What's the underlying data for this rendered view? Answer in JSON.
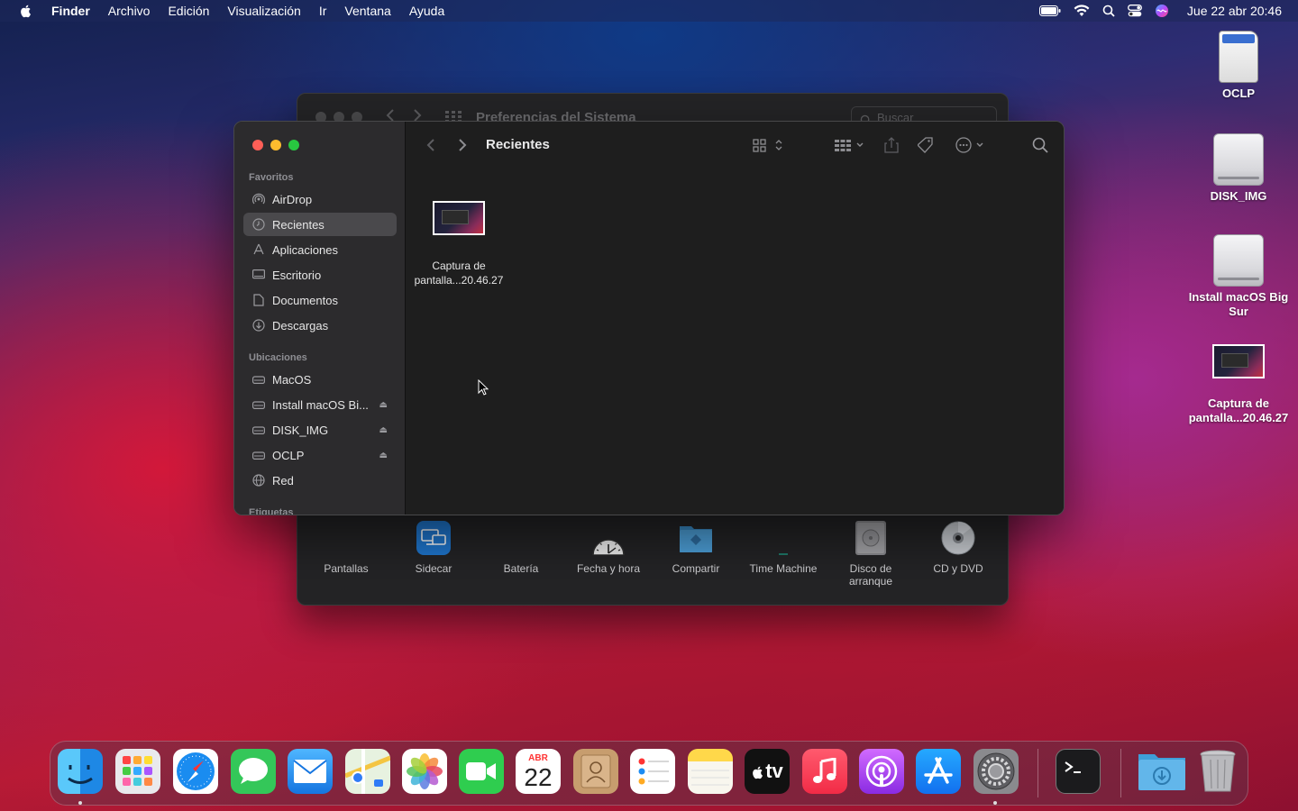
{
  "menubar": {
    "app_name": "Finder",
    "items": [
      "Archivo",
      "Edición",
      "Visualización",
      "Ir",
      "Ventana",
      "Ayuda"
    ],
    "clock": "Jue 22 abr  20:46",
    "status_icons": [
      "battery-icon",
      "wifi-icon",
      "spotlight-icon",
      "control-center-icon",
      "siri-icon"
    ]
  },
  "desktop": {
    "icons": [
      {
        "label": "OCLP",
        "icon": "sd-card-icon"
      },
      {
        "label": "DISK_IMG",
        "icon": "drive-icon"
      },
      {
        "label": "Install macOS Big Sur",
        "icon": "drive-icon"
      },
      {
        "label": "Captura de pantalla...20.46.27",
        "icon": "screenshot-file-icon"
      }
    ]
  },
  "system_prefs": {
    "title": "Preferencias del Sistema",
    "search_placeholder": "Buscar",
    "panes": [
      "Pantallas",
      "Sidecar",
      "Batería",
      "Fecha y hora",
      "Compartir",
      "Time Machine",
      "Disco de arranque",
      "CD y DVD"
    ]
  },
  "finder": {
    "title": "Recientes",
    "favorites_title": "Favoritos",
    "favorites": [
      {
        "label": "AirDrop",
        "icon": "airdrop-icon"
      },
      {
        "label": "Recientes",
        "icon": "clock-icon",
        "active": true
      },
      {
        "label": "Aplicaciones",
        "icon": "applications-icon"
      },
      {
        "label": "Escritorio",
        "icon": "desktop-icon"
      },
      {
        "label": "Documentos",
        "icon": "document-icon"
      },
      {
        "label": "Descargas",
        "icon": "download-icon"
      }
    ],
    "locations_title": "Ubicaciones",
    "locations": [
      {
        "label": "MacOS",
        "icon": "drive-icon",
        "eject": false
      },
      {
        "label": "Install macOS Bi...",
        "icon": "drive-icon",
        "eject": true
      },
      {
        "label": "DISK_IMG",
        "icon": "drive-icon",
        "eject": true
      },
      {
        "label": "OCLP",
        "icon": "drive-icon",
        "eject": true
      },
      {
        "label": "Red",
        "icon": "globe-icon",
        "eject": false
      }
    ],
    "tags_title": "Etiquetas",
    "files": [
      {
        "name": "Captura de pantalla...20.46.27"
      }
    ]
  },
  "dock": {
    "apps": [
      "Finder",
      "Launchpad",
      "Safari",
      "Mensajes",
      "Mail",
      "Mapas",
      "Fotos",
      "FaceTime",
      "Calendario",
      "Contactos",
      "Recordatorios",
      "Notas",
      "TV",
      "Música",
      "Podcasts",
      "App Store",
      "Preferencias del Sistema",
      "Terminal",
      "Descargas",
      "Papelera"
    ],
    "calendar": {
      "month": "ABR",
      "day": "22"
    },
    "tv_label": "tv"
  }
}
